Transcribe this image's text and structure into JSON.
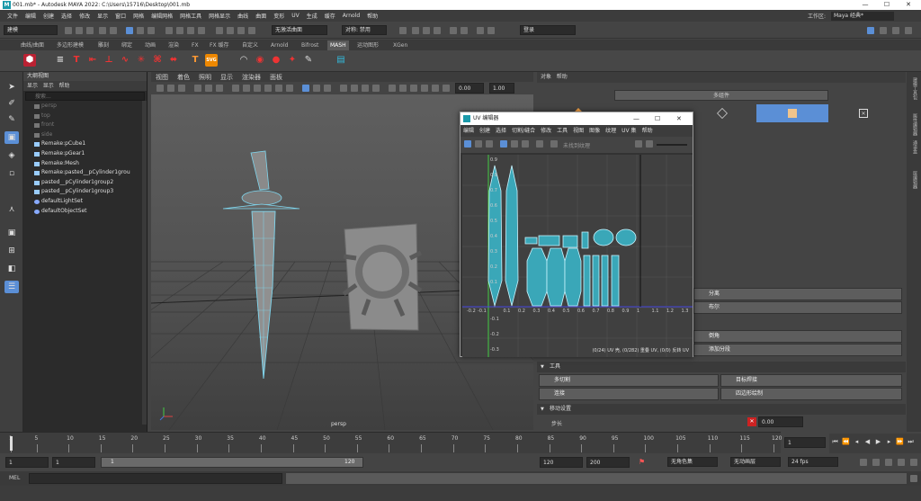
{
  "window": {
    "title": "001.mb* - Autodesk MAYA 2022: C:\\Users\\15716\\Desktop\\001.mb",
    "minimize": "—",
    "maximize": "☐",
    "close": "✕"
  },
  "menu": [
    "文件",
    "编辑",
    "创建",
    "选择",
    "修改",
    "显示",
    "窗口",
    "网格",
    "编辑网格",
    "网格工具",
    "网格显示",
    "曲线",
    "曲面",
    "变形",
    "UV",
    "生成",
    "缓存",
    "Arnold",
    "帮助"
  ],
  "workspace": {
    "label": "工作区:",
    "value": "Maya 经典*"
  },
  "status": {
    "mode": "建模",
    "live": "无激活曲面",
    "symmetry": "对称: 禁用",
    "login": "登录"
  },
  "shelf_tabs": [
    "曲线/曲面",
    "多边形建模",
    "雕刻",
    "绑定",
    "动画",
    "渲染",
    "FX",
    "FX 缓存",
    "自定义",
    "Arnold",
    "Bifrost",
    "MASH",
    "运动图形",
    "XGen"
  ],
  "shelf_active": "MASH",
  "outliner": {
    "title": "大纲视图",
    "menu": [
      "显示",
      "显示",
      "帮助"
    ],
    "search": "搜索...",
    "items": [
      {
        "label": "persp",
        "dim": true
      },
      {
        "label": "top",
        "dim": true
      },
      {
        "label": "front",
        "dim": true
      },
      {
        "label": "side",
        "dim": true
      },
      {
        "label": "Remake:pCube1",
        "dim": false
      },
      {
        "label": "Remake:pGear1",
        "dim": false
      },
      {
        "label": "Remake:Mesh",
        "dim": false
      },
      {
        "label": "Remake:pasted__pCylinder1grou",
        "dim": false
      },
      {
        "label": "pasted__pCylinder1group2",
        "dim": false
      },
      {
        "label": "pasted__pCylinder1group3",
        "dim": false
      },
      {
        "label": "defaultLightSet",
        "dim": false
      },
      {
        "label": "defaultObjectSet",
        "dim": false
      }
    ]
  },
  "viewport": {
    "menu": [
      "视图",
      "着色",
      "照明",
      "显示",
      "渲染器",
      "面板"
    ],
    "camera": "persp",
    "value1": "0.00",
    "value2": "1.00"
  },
  "uv_editor": {
    "title": "UV 编辑器",
    "menu": [
      "编辑",
      "创建",
      "选择",
      "切割/缝合",
      "修改",
      "工具",
      "视图",
      "图像",
      "纹理",
      "UV 集",
      "帮助"
    ],
    "texture_placeholder": "未找到纹理",
    "status": "(0/24) UV 壳, (0/282) 重叠 UV, (0/0) 反转 UV",
    "v_ticks": [
      "0.9",
      "0.8",
      "0.7",
      "0.6",
      "0.5",
      "0.4",
      "0.3",
      "0.2",
      "0.1",
      "-0.1",
      "-0.2",
      "-0.3"
    ],
    "u_ticks": [
      "-0.2",
      "-0.1",
      "0.1",
      "0.2",
      "0.3",
      "0.4",
      "0.5",
      "0.6",
      "0.7",
      "0.8",
      "0.9",
      "1",
      "1.1",
      "1.2",
      "1.3"
    ]
  },
  "attr": {
    "menu": [
      "对象",
      "帮助"
    ],
    "component_btn": "多组件",
    "buttons": {
      "separate": "分离",
      "boolean": "布尔",
      "bevel": "倒角",
      "add_divisions": "添加分段"
    },
    "tools_section": "工具",
    "tools": {
      "multicut": "多切割",
      "target_weld": "目标焊接",
      "connect": "连接",
      "quad_draw": "四边形绘制"
    },
    "move_section": "移动设置",
    "move_field": "0.00",
    "move_label": "步长"
  },
  "sidebar_tabs": [
    "建模工具包",
    "属性编辑器",
    "通道盒",
    "层编辑器"
  ],
  "timeline": {
    "ticks": [
      "1",
      "5",
      "10",
      "15",
      "20",
      "25",
      "30",
      "35",
      "40",
      "45",
      "50",
      "55",
      "60",
      "65",
      "70",
      "75",
      "80",
      "85",
      "90",
      "95",
      "100",
      "105",
      "110",
      "115",
      "120"
    ],
    "current": "1"
  },
  "range": {
    "start": "1",
    "start2": "1",
    "range_start": "1",
    "range_end": "120",
    "end": "120",
    "end2": "200",
    "char_set": "无角色集",
    "anim_layer": "无动画层",
    "fps": "24 fps"
  },
  "cmd": {
    "label": "MEL"
  }
}
